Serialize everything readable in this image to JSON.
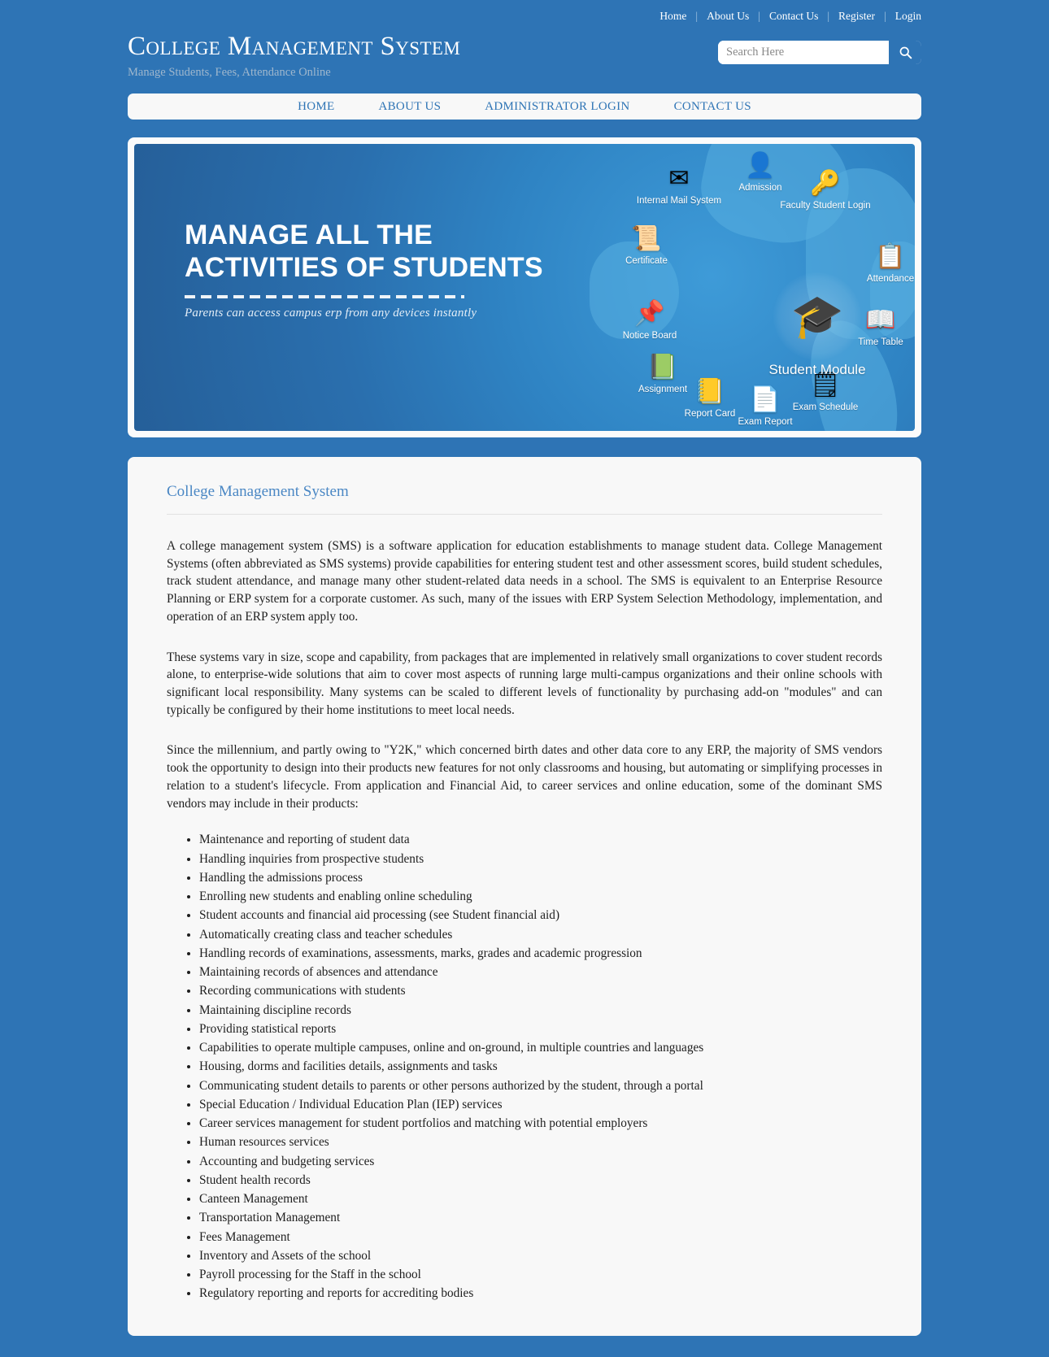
{
  "colors": {
    "page_background": "#2e74b5",
    "panel_background": "#f8f8f8",
    "accent_link": "#2e74b5",
    "heading": "#4a87c4",
    "tagline": "#9fb7cd"
  },
  "topbar": {
    "links": [
      {
        "label": "Home"
      },
      {
        "label": "About Us"
      },
      {
        "label": "Contact Us"
      },
      {
        "label": "Register"
      },
      {
        "label": "Login"
      }
    ],
    "separator": "|"
  },
  "header": {
    "title": "College Management System",
    "tagline": "Manage Students, Fees, Attendance Online",
    "search": {
      "placeholder": "Search Here",
      "value": "",
      "button_icon": "search-icon"
    }
  },
  "nav": {
    "items": [
      {
        "label": "HOME"
      },
      {
        "label": "ABOUT US"
      },
      {
        "label": "ADMINISTRATOR LOGIN"
      },
      {
        "label": "CONTACT US"
      }
    ]
  },
  "banner": {
    "headline_line1": "MANAGE ALL THE",
    "headline_line2": "ACTIVITIES OF STUDENTS",
    "subtitle": "Parents can access campus erp from any devices instantly",
    "center_node": {
      "label": "Student Module",
      "icon": "graduates-icon",
      "glyph": "🎓"
    },
    "nodes": [
      {
        "label": "Internal Mail System",
        "icon": "mail-icon",
        "glyph": "✉"
      },
      {
        "label": "Admission",
        "icon": "admission-icon",
        "glyph": "👤"
      },
      {
        "label": "Faculty Student Login",
        "icon": "key-login-icon",
        "glyph": "🔑"
      },
      {
        "label": "Certificate",
        "icon": "certificate-icon",
        "glyph": "📜"
      },
      {
        "label": "Attendance",
        "icon": "attendance-icon",
        "glyph": "📋"
      },
      {
        "label": "Notice Board",
        "icon": "notice-board-icon",
        "glyph": "📌"
      },
      {
        "label": "Time Table",
        "icon": "time-table-icon",
        "glyph": "📖"
      },
      {
        "label": "Assignment",
        "icon": "assignment-icon",
        "glyph": "📗"
      },
      {
        "label": "Report Card",
        "icon": "report-card-icon",
        "glyph": "📒"
      },
      {
        "label": "Exam Report",
        "icon": "exam-report-icon",
        "glyph": "📄"
      },
      {
        "label": "Exam Schedule",
        "icon": "exam-schedule-icon",
        "glyph": "🗒"
      }
    ]
  },
  "main": {
    "heading": "College Management System",
    "paragraphs": [
      "A college management system (SMS) is a software application for education establishments to manage student data. College Management Systems (often abbreviated as SMS systems) provide capabilities for entering student test and other assessment scores, build student schedules, track student attendance, and manage many other student-related data needs in a school. The SMS is equivalent to an Enterprise Resource Planning or ERP system for a corporate customer. As such, many of the issues with ERP System Selection Methodology, implementation, and operation of an ERP system apply too.",
      "These systems vary in size, scope and capability, from packages that are implemented in relatively small organizations to cover student records alone, to enterprise-wide solutions that aim to cover most aspects of running large multi-campus organizations and their online schools with significant local responsibility. Many systems can be scaled to different levels of functionality by purchasing add-on \"modules\" and can typically be configured by their home institutions to meet local needs.",
      "Since the millennium, and partly owing to \"Y2K,\" which concerned birth dates and other data core to any ERP, the majority of SMS vendors took the opportunity to design into their products new features for not only classrooms and housing, but automating or simplifying processes in relation to a student's lifecycle. From application and Financial Aid, to career services and online education, some of the dominant SMS vendors may include in their products:"
    ],
    "features": [
      "Maintenance and reporting of student data",
      "Handling inquiries from prospective students",
      "Handling the admissions process",
      "Enrolling new students and enabling online scheduling",
      "Student accounts and financial aid processing (see Student financial aid)",
      "Automatically creating class and teacher schedules",
      "Handling records of examinations, assessments, marks, grades and academic progression",
      "Maintaining records of absences and attendance",
      "Recording communications with students",
      "Maintaining discipline records",
      "Providing statistical reports",
      "Capabilities to operate multiple campuses, online and on-ground, in multiple countries and languages",
      "Housing, dorms and facilities details, assignments and tasks",
      "Communicating student details to parents or other persons authorized by the student, through a portal",
      "Special Education / Individual Education Plan (IEP) services",
      "Career services management for student portfolios and matching with potential employers",
      "Human resources services",
      "Accounting and budgeting services",
      "Student health records",
      "Canteen Management",
      "Transportation Management",
      "Fees Management",
      "Inventory and Assets of the school",
      "Payroll processing for the Staff in the school",
      "Regulatory reporting and reports for accrediting bodies"
    ]
  }
}
